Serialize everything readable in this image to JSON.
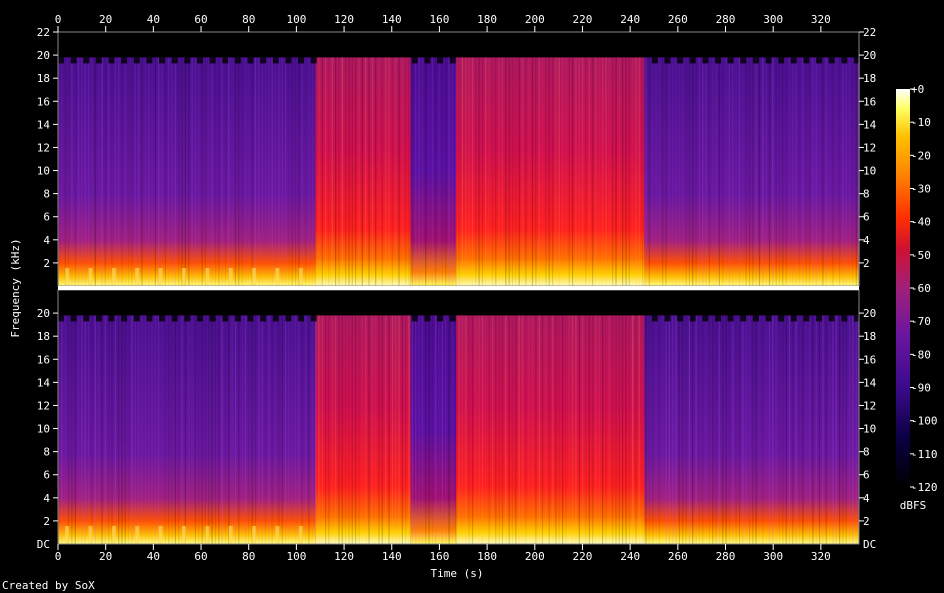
{
  "chart_data": {
    "type": "heatmap",
    "title": "",
    "xlabel": "Time (s)",
    "ylabel": "Frequency (kHz)",
    "footer": "Created by SoX",
    "colorbar_label": "dBFS",
    "colorbar_ticks": [
      "+0",
      "-10",
      "-20",
      "-30",
      "-40",
      "-50",
      "-60",
      "-70",
      "-80",
      "-90",
      "-100",
      "-110",
      "-120"
    ],
    "colorbar_range": [
      -120,
      0
    ],
    "x_ticks": [
      "0",
      "20",
      "40",
      "60",
      "80",
      "100",
      "120",
      "140",
      "160",
      "180",
      "200",
      "220",
      "240",
      "260",
      "280",
      "300",
      "320"
    ],
    "xlim": [
      0,
      336
    ],
    "ylim_khz": [
      0,
      22
    ],
    "channels": [
      {
        "name": "",
        "y_ticks_top": [
          "22",
          "20",
          "18",
          "16",
          "14",
          "12",
          "10",
          "8",
          "6",
          "4",
          "2"
        ],
        "bottom_label": ""
      },
      {
        "name": "",
        "y_ticks_top": [
          "20",
          "18",
          "16",
          "14",
          "12",
          "10",
          "8",
          "6",
          "4",
          "2"
        ],
        "bottom_label": "DC"
      }
    ],
    "segments": [
      {
        "t_start": 0,
        "t_end": 108,
        "level_db": -85,
        "description": "quiet intro, energy mostly below 3 kHz"
      },
      {
        "t_start": 108,
        "t_end": 148,
        "level_db": -55,
        "description": "loud broadband section"
      },
      {
        "t_start": 148,
        "t_end": 167,
        "level_db": -75,
        "description": "quieter break"
      },
      {
        "t_start": 167,
        "t_end": 246,
        "level_db": -52,
        "description": "loud broadband section"
      },
      {
        "t_start": 246,
        "t_end": 290,
        "level_db": -82,
        "description": "quiet section"
      },
      {
        "t_start": 290,
        "t_end": 336,
        "level_db": -88,
        "description": "quiet outro"
      }
    ],
    "cutoff_khz": 19.8,
    "colors": {
      "background": "#000000",
      "palette": [
        "#000000",
        "#0a0040",
        "#3a0a8a",
        "#6a15a0",
        "#a0207a",
        "#d01030",
        "#ff3000",
        "#ff8000",
        "#ffc000",
        "#ffff60",
        "#ffffff"
      ]
    }
  }
}
